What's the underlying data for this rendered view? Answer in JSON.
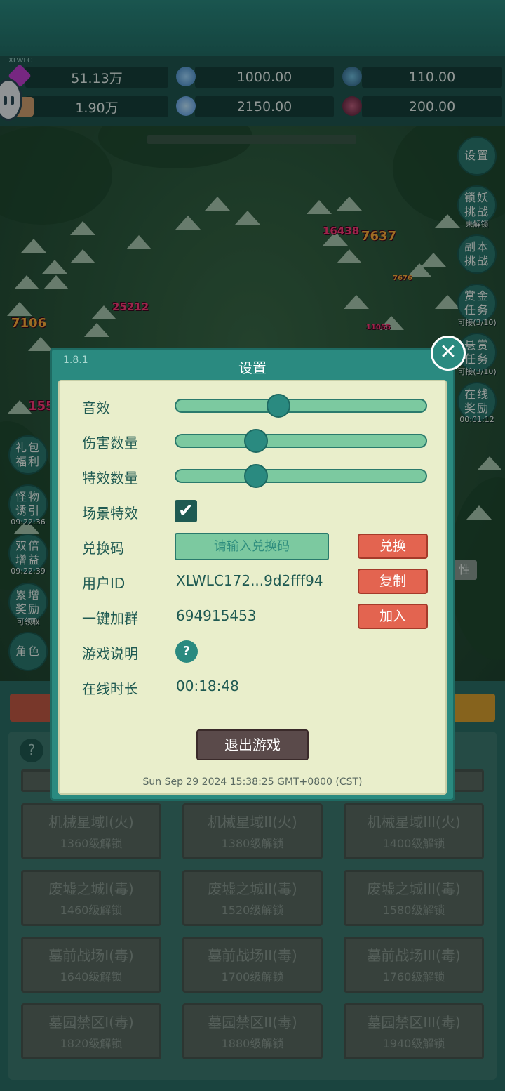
{
  "header": {
    "user_tag": "XLWLC"
  },
  "resources": [
    {
      "icon": "diamond-icon",
      "value": "51.13万",
      "color": "#c040d0"
    },
    {
      "icon": "crystal-icon",
      "value": "1000.00",
      "color": "#4aa0e0"
    },
    {
      "icon": "orb-icon",
      "value": "110.00",
      "color": "#3a8ab0"
    },
    {
      "icon": "scroll-icon",
      "value": "1.90万",
      "color": "#d0a070"
    },
    {
      "icon": "ice-shard-icon",
      "value": "2150.00",
      "color": "#6ab0f0"
    },
    {
      "icon": "pouch-icon",
      "value": "200.00",
      "color": "#a04060"
    }
  ],
  "right_menu": [
    {
      "label": "设置",
      "sub": ""
    },
    {
      "label": "锁妖挑战",
      "sub": "未解锁"
    },
    {
      "label": "副本挑战",
      "sub": ""
    },
    {
      "label": "赏金任务",
      "sub": "可接(3/10)"
    },
    {
      "label": "悬赏任务",
      "sub": "可接(3/10)"
    },
    {
      "label": "在线奖励",
      "sub": "00:01:12"
    }
  ],
  "left_menu": [
    {
      "label": "礼包福利",
      "sub": ""
    },
    {
      "label": "怪物诱引",
      "sub": "09:22:36"
    },
    {
      "label": "双倍增益",
      "sub": "09:22:39"
    },
    {
      "label": "累增奖励",
      "sub": "可领取"
    },
    {
      "label": "角色",
      "sub": ""
    }
  ],
  "damage_numbers": [
    "16438",
    "7637",
    "25212",
    "7106",
    "155",
    "11055",
    "7676"
  ],
  "side_tag": "性",
  "settings": {
    "version": "1.8.1",
    "title": "设置",
    "close": "✕",
    "sound_label": "音效",
    "sound_level": 0.4,
    "damage_label": "伤害数量",
    "damage_level": 0.3,
    "effect_label": "特效数量",
    "effect_level": 0.3,
    "scene_label": "场景特效",
    "scene_checked": "✔",
    "redeem_label": "兑换码",
    "redeem_placeholder": "请输入兑换码",
    "redeem_button": "兑换",
    "userid_label": "用户ID",
    "userid_value": "XLWLC172...9d2fff94",
    "copy_button": "复制",
    "group_label": "一键加群",
    "group_value": "694915453",
    "join_button": "加入",
    "help_label": "游戏说明",
    "help_icon": "?",
    "online_label": "在线时长",
    "online_value": "00:18:48",
    "quit_button": "退出游戏",
    "timestamp": "Sun Sep 29 2024 15:38:25 GMT+0800 (CST)"
  },
  "zones": [
    {
      "name": "机械星域I(火)",
      "lock": "1360级解锁"
    },
    {
      "name": "机械星域II(火)",
      "lock": "1380级解锁"
    },
    {
      "name": "机械星域III(火)",
      "lock": "1400级解锁"
    },
    {
      "name": "废墟之城I(毒)",
      "lock": "1460级解锁"
    },
    {
      "name": "废墟之城II(毒)",
      "lock": "1520级解锁"
    },
    {
      "name": "废墟之城III(毒)",
      "lock": "1580级解锁"
    },
    {
      "name": "墓前战场I(毒)",
      "lock": "1640级解锁"
    },
    {
      "name": "墓前战场II(毒)",
      "lock": "1700级解锁"
    },
    {
      "name": "墓前战场III(毒)",
      "lock": "1760级解锁"
    },
    {
      "name": "墓园禁区I(毒)",
      "lock": "1820级解锁"
    },
    {
      "name": "墓园禁区II(毒)",
      "lock": "1880级解锁"
    },
    {
      "name": "墓园禁区III(毒)",
      "lock": "1940级解锁"
    }
  ],
  "help_bottom": "?"
}
